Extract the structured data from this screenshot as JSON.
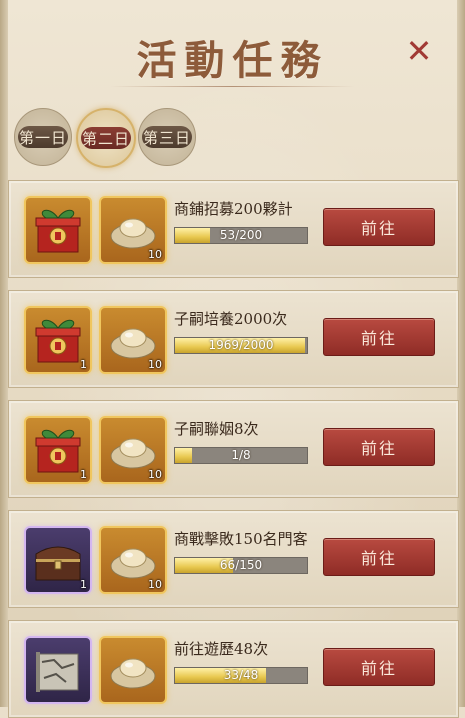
{
  "header": {
    "title": "活動任務",
    "close_symbol": "✕"
  },
  "day_tabs": [
    {
      "label": "第一日",
      "active": false
    },
    {
      "label": "第二日",
      "active": true
    },
    {
      "label": "第三日",
      "active": false
    }
  ],
  "tasks": [
    {
      "name": "商鋪招募200夥計",
      "progress_text": "53/200",
      "progress": 0.265,
      "go_label": "前往",
      "rewards": [
        {
          "icon": "gift-box-icon",
          "count": ""
        },
        {
          "icon": "silver-ingot-icon",
          "count": "10"
        }
      ]
    },
    {
      "name": "子嗣培養2000次",
      "progress_text": "1969/2000",
      "progress": 0.9845,
      "go_label": "前往",
      "rewards": [
        {
          "icon": "gift-box-icon",
          "count": "1"
        },
        {
          "icon": "silver-ingot-icon",
          "count": "10"
        }
      ]
    },
    {
      "name": "子嗣聯姻8次",
      "progress_text": "1/8",
      "progress": 0.125,
      "go_label": "前往",
      "rewards": [
        {
          "icon": "gift-box-icon",
          "count": "1"
        },
        {
          "icon": "silver-ingot-icon",
          "count": "10"
        }
      ]
    },
    {
      "name": "商戰擊敗150名門客",
      "progress_text": "66/150",
      "progress": 0.44,
      "go_label": "前往",
      "rewards": [
        {
          "icon": "treasure-chest-icon",
          "count": "1"
        },
        {
          "icon": "silver-ingot-icon",
          "count": "10"
        }
      ]
    },
    {
      "name": "前往遊歷48次",
      "progress_text": "33/48",
      "progress": 0.6875,
      "go_label": "前往",
      "rewards": [
        {
          "icon": "map-scroll-icon",
          "count": ""
        },
        {
          "icon": "silver-ingot-icon",
          "count": ""
        }
      ]
    }
  ],
  "colors": {
    "accent_red": "#a13a35",
    "title_brown": "#8d5b3a",
    "progress_gold": "#e8c84f",
    "button_red": "#b84a40"
  }
}
